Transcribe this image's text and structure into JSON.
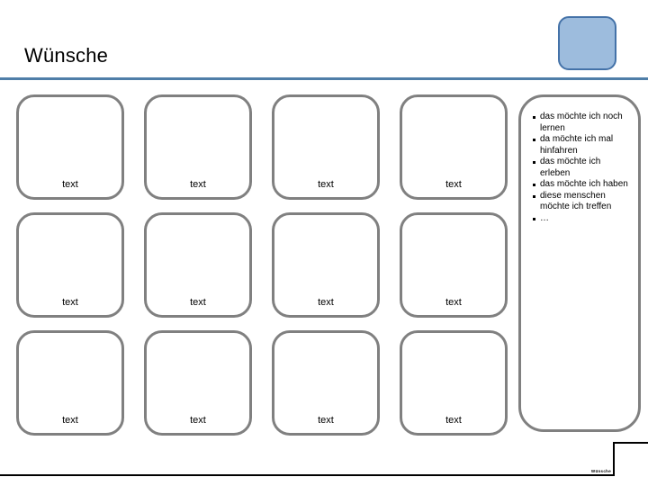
{
  "slide": {
    "title": "Wünsche",
    "accent_color": "#4f7ea8",
    "box_border_color": "#808080",
    "deco_fill_color": "#9dbcdd",
    "deco_border_color": "#4472a8"
  },
  "grid": {
    "columns": 4,
    "rows": 3,
    "cells": [
      {
        "label": "text"
      },
      {
        "label": "text"
      },
      {
        "label": "text"
      },
      {
        "label": "text"
      },
      {
        "label": "text"
      },
      {
        "label": "text"
      },
      {
        "label": "text"
      },
      {
        "label": "text"
      },
      {
        "label": "text"
      },
      {
        "label": "text"
      },
      {
        "label": "text"
      },
      {
        "label": "text"
      }
    ]
  },
  "bullet_panel": {
    "items": [
      "das möchte ich noch lernen",
      "da möchte ich mal hinfahren",
      "das möchte ich erleben",
      "das möchte ich haben",
      "diese menschen möchte ich treffen",
      "…"
    ]
  },
  "footer": {
    "note": "Wünsche"
  }
}
